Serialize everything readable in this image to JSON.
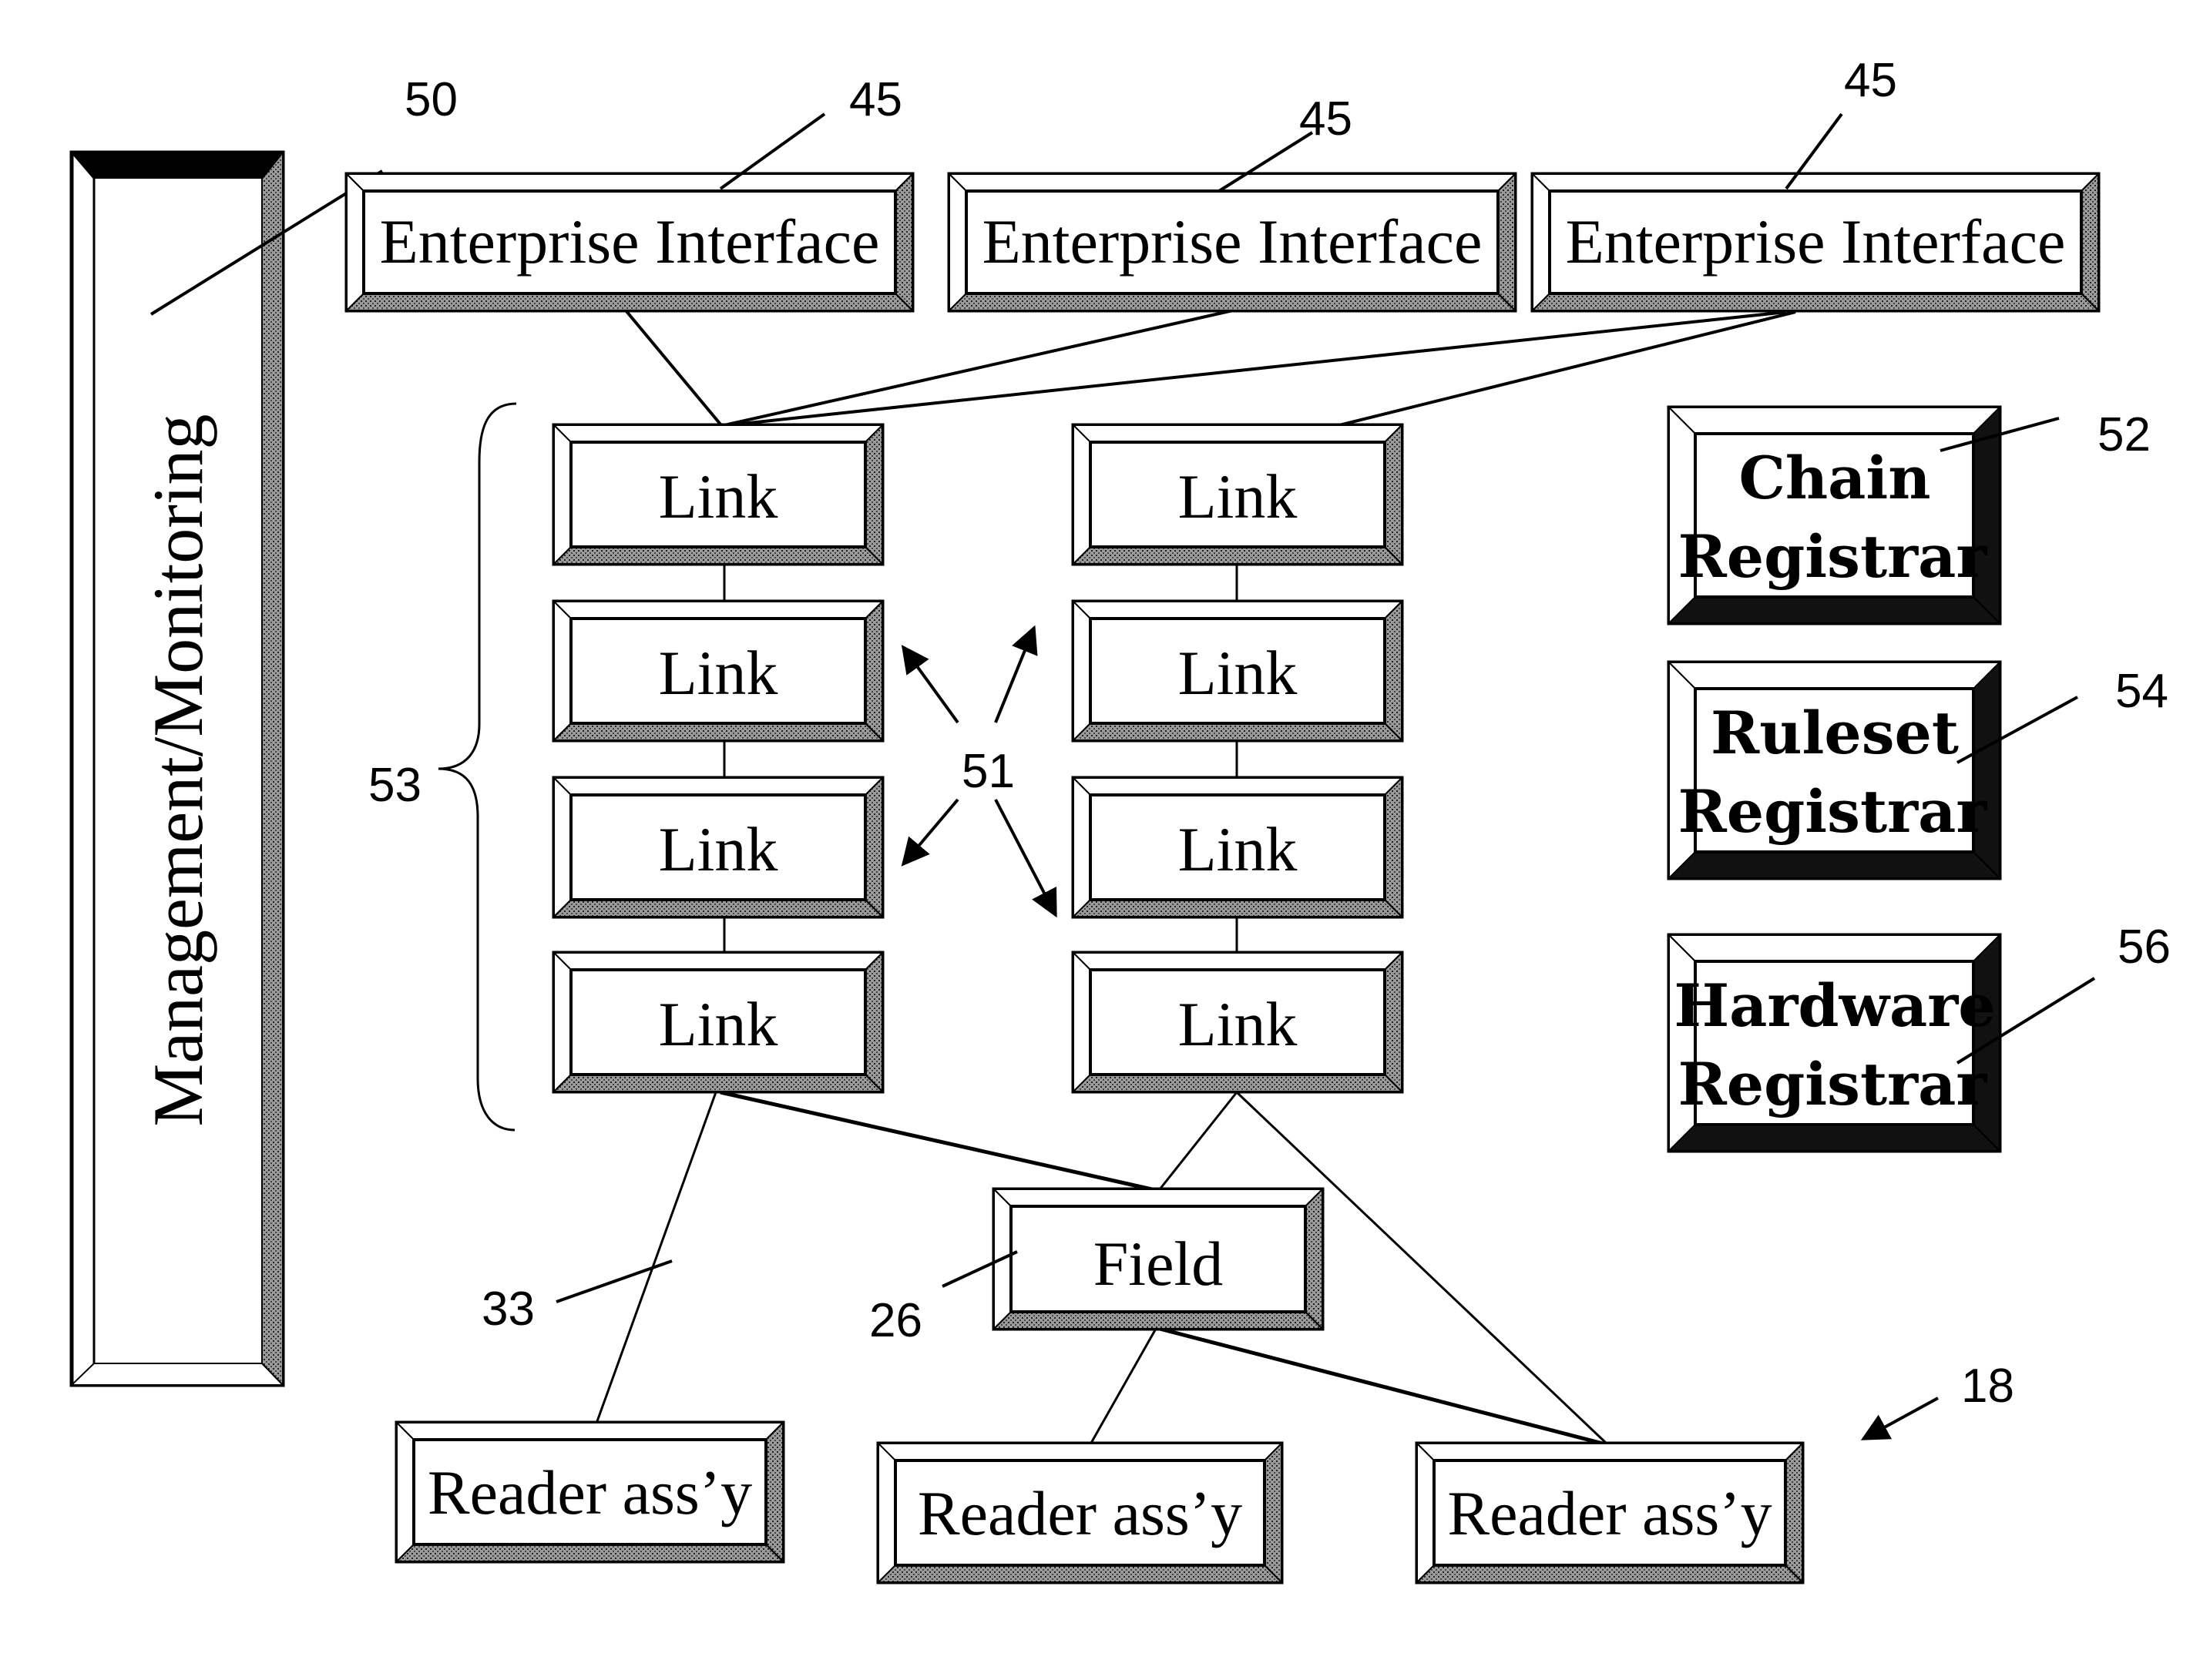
{
  "figure": {
    "reference_numeral": "18"
  },
  "management": {
    "label": "Management/Monitoring",
    "ref": "50"
  },
  "enterprise_interfaces": [
    {
      "label": "Enterprise Interface",
      "ref": "45"
    },
    {
      "label": "Enterprise Interface",
      "ref": "45"
    },
    {
      "label": "Enterprise Interface",
      "ref": "45"
    }
  ],
  "link_chain": {
    "ref": "53",
    "links_ref": "51",
    "columns": [
      {
        "links": [
          "Link",
          "Link",
          "Link",
          "Link"
        ]
      },
      {
        "links": [
          "Link",
          "Link",
          "Link",
          "Link"
        ]
      }
    ]
  },
  "registrars": [
    {
      "line1": "Chain",
      "line2": "Registrar",
      "ref": "52"
    },
    {
      "line1": "Ruleset",
      "line2": "Registrar",
      "ref": "54"
    },
    {
      "line1": "Hardware",
      "line2": "Registrar",
      "ref": "56"
    }
  ],
  "field": {
    "label": "Field",
    "ref": "26"
  },
  "connection_ref": "33",
  "readers": [
    {
      "label": "Reader ass’y"
    },
    {
      "label": "Reader ass’y"
    },
    {
      "label": "Reader ass’y"
    }
  ]
}
